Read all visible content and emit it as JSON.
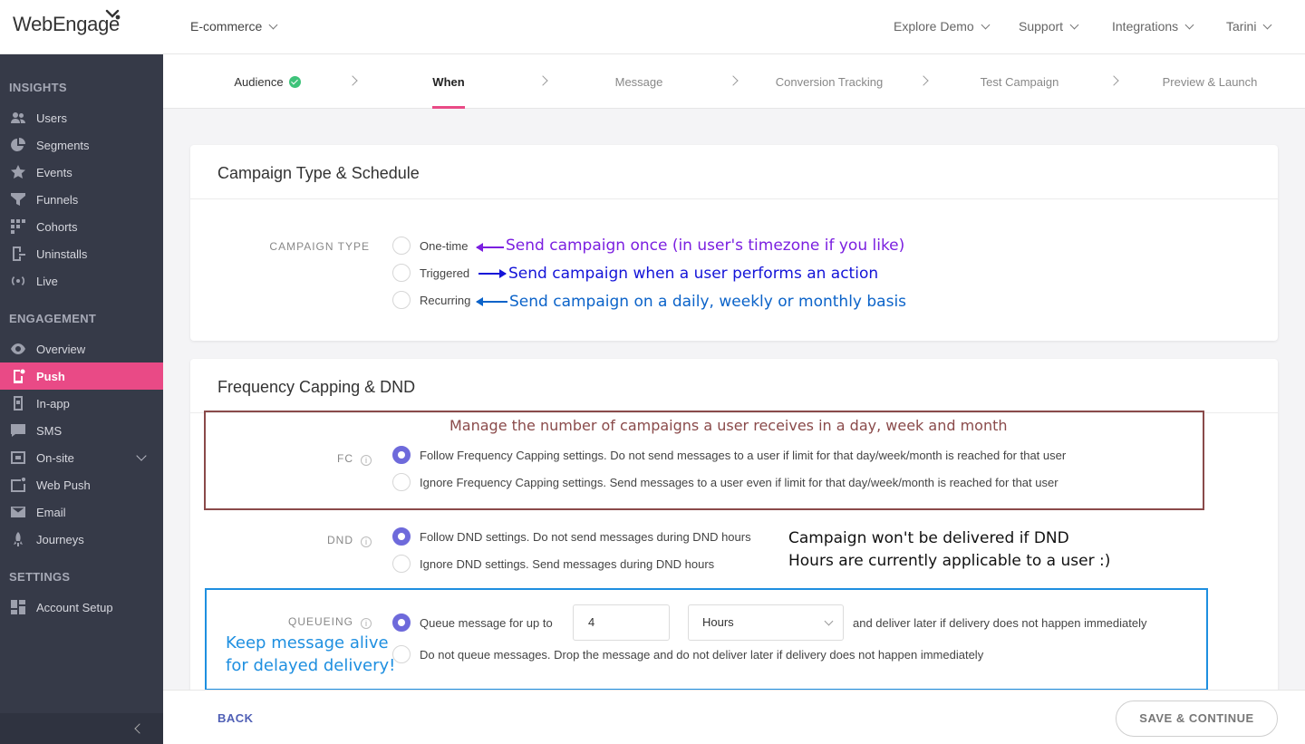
{
  "app": {
    "logo_text": "WebEngage",
    "project": "E-commerce",
    "nav": [
      "Explore Demo",
      "Support",
      "Integrations",
      "Tarini"
    ]
  },
  "sidebar": {
    "sections": [
      {
        "title": "INSIGHTS",
        "items": [
          {
            "label": "Users",
            "icon": "users-icon"
          },
          {
            "label": "Segments",
            "icon": "pie-icon"
          },
          {
            "label": "Events",
            "icon": "star-icon"
          },
          {
            "label": "Funnels",
            "icon": "funnel-icon"
          },
          {
            "label": "Cohorts",
            "icon": "grid-icon"
          },
          {
            "label": "Uninstalls",
            "icon": "uninstall-icon"
          },
          {
            "label": "Live",
            "icon": "broadcast-icon"
          }
        ]
      },
      {
        "title": "ENGAGEMENT",
        "items": [
          {
            "label": "Overview",
            "icon": "eye-icon"
          },
          {
            "label": "Push",
            "icon": "mobile-icon",
            "active": true
          },
          {
            "label": "In-app",
            "icon": "inapp-icon"
          },
          {
            "label": "SMS",
            "icon": "sms-icon"
          },
          {
            "label": "On-site",
            "icon": "onsite-icon"
          },
          {
            "label": "Web Push",
            "icon": "webpush-icon"
          },
          {
            "label": "Email",
            "icon": "mail-icon"
          },
          {
            "label": "Journeys",
            "icon": "rocket-icon"
          }
        ]
      },
      {
        "title": "SETTINGS",
        "items": [
          {
            "label": "Account Setup",
            "icon": "dashboard-icon"
          }
        ]
      }
    ]
  },
  "steps": [
    "Audience",
    "When",
    "Message",
    "Conversion Tracking",
    "Test Campaign",
    "Preview & Launch"
  ],
  "campaign_type_card": {
    "title": "Campaign Type & Schedule",
    "label": "CAMPAIGN TYPE",
    "options": [
      "One-time",
      "Triggered",
      "Recurring"
    ],
    "annotations": [
      "Send campaign once (in user's timezone if you like)",
      "Send campaign when a user performs an action",
      "Send campaign on a daily, weekly or monthly basis"
    ]
  },
  "fc_card": {
    "title": "Frequency Capping & DND",
    "fc_annotation": "Manage the number of campaigns a user receives in a day, week and month",
    "fc_label": "FC",
    "fc_options": [
      "Follow Frequency Capping settings. Do not send messages to a user if limit for that day/week/month is reached for that user",
      "Ignore Frequency Capping settings. Send messages to a user even if limit for that day/week/month is reached for that user"
    ],
    "dnd_label": "DND",
    "dnd_options": [
      "Follow DND settings. Do not send messages during DND hours",
      "Ignore DND settings. Send messages during DND hours"
    ],
    "dnd_annotation": [
      "Campaign won't be delivered if DND",
      "Hours are currently applicable to a user :)"
    ],
    "queue_label": "QUEUEING",
    "queue_annotation": [
      "Keep message alive",
      "for delayed delivery!"
    ],
    "queue_prefix": "Queue message for up to",
    "queue_value": "4",
    "queue_unit": "Hours",
    "queue_suffix": "and deliver later if delivery does not happen immediately",
    "queue_option2": "Do not queue messages. Drop the message and do not deliver later if delivery does not happen immediately"
  },
  "footer": {
    "back": "BACK",
    "save": "SAVE & CONTINUE"
  },
  "colors": {
    "accent": "#e94a86",
    "radio": "#6e6adb",
    "sidebar": "#363a48",
    "annot_purple": "#7b1fe0",
    "annot_blue": "#1414d8",
    "annot_azure": "#0b63c9",
    "annot_brown": "#8a4a4a",
    "annot_cyan": "#1e8fe0"
  }
}
